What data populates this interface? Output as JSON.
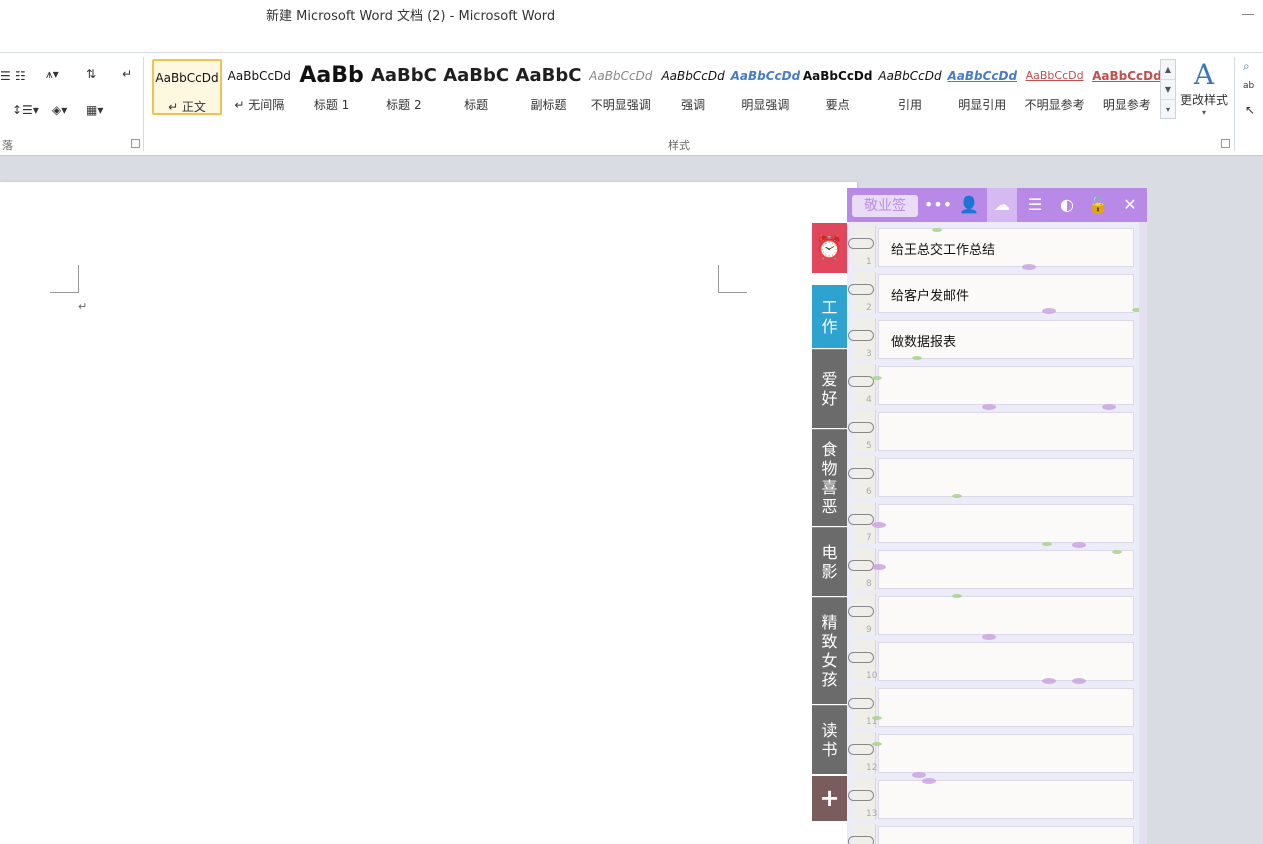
{
  "window": {
    "title": "新建 Microsoft Word 文档 (2)  -  Microsoft Word"
  },
  "ribbon": {
    "paragraph_group_label": "落",
    "styles_group_label": "样式",
    "styles": [
      {
        "sample": "AaBbCcDd",
        "name": "↵ 正文",
        "selected": true
      },
      {
        "sample": "AaBbCcDd",
        "name": "↵ 无间隔"
      },
      {
        "sample": "AaBb",
        "name": "标题 1"
      },
      {
        "sample": "AaBbC",
        "name": "标题 2"
      },
      {
        "sample": "AaBbC",
        "name": "标题"
      },
      {
        "sample": "AaBbC",
        "name": "副标题"
      },
      {
        "sample": "AaBbCcDd",
        "name": "不明显强调"
      },
      {
        "sample": "AaBbCcDd",
        "name": "强调"
      },
      {
        "sample": "AaBbCcDd",
        "name": "明显强调"
      },
      {
        "sample": "AaBbCcDd",
        "name": "要点"
      },
      {
        "sample": "AaBbCcDd",
        "name": "引用"
      },
      {
        "sample": "AaBbCcDd",
        "name": "明显引用"
      },
      {
        "sample": "AaBbCcDd",
        "name": "不明显参考"
      },
      {
        "sample": "AaBbCcDd",
        "name": "明显参考"
      }
    ],
    "change_styles_label": "更改样式"
  },
  "sticky_notes": {
    "brand": "敬业签",
    "tabs": [
      {
        "label": "",
        "color": "#e0475c",
        "icon": "alarm-clock-icon"
      },
      {
        "label": "工作",
        "color": "#2fa3cf"
      },
      {
        "label": "爱好",
        "color": "#6b6b6b"
      },
      {
        "label": "食物喜恶",
        "color": "#6b6b6b"
      },
      {
        "label": "电影",
        "color": "#6b6b6b"
      },
      {
        "label": "精致女孩",
        "color": "#6b6b6b"
      },
      {
        "label": "读书",
        "color": "#6b6b6b"
      },
      {
        "label": "+",
        "color": "#7a5c5c",
        "icon": "plus-icon"
      }
    ],
    "notes": [
      {
        "num": "1",
        "text": "给王总交工作总结"
      },
      {
        "num": "2",
        "text": "给客户发邮件"
      },
      {
        "num": "3",
        "text": "做数据报表"
      },
      {
        "num": "4",
        "text": ""
      },
      {
        "num": "5",
        "text": ""
      },
      {
        "num": "6",
        "text": ""
      },
      {
        "num": "7",
        "text": ""
      },
      {
        "num": "8",
        "text": ""
      },
      {
        "num": "9",
        "text": ""
      },
      {
        "num": "10",
        "text": ""
      },
      {
        "num": "11",
        "text": ""
      },
      {
        "num": "12",
        "text": ""
      },
      {
        "num": "13",
        "text": ""
      },
      {
        "num": "",
        "text": ""
      }
    ],
    "colors": {
      "header": "#b889e6",
      "active_tab": "#2fa3cf"
    }
  }
}
